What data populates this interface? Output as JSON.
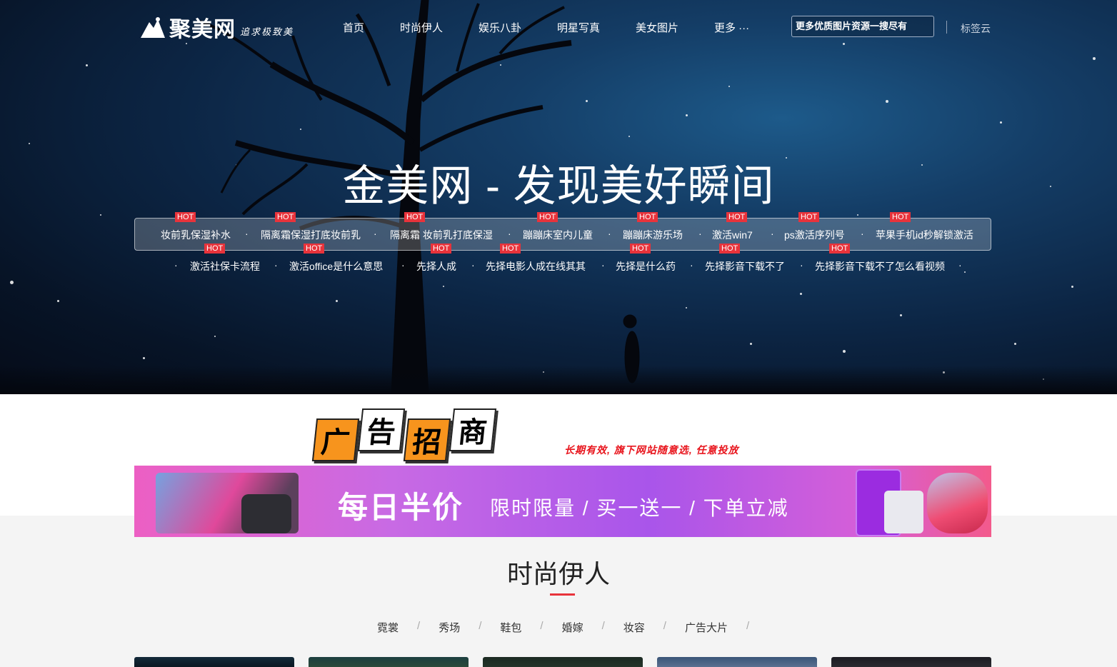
{
  "header": {
    "logo_text": "聚美网",
    "logo_slogan": "追求极致美",
    "nav": [
      "首页",
      "时尚伊人",
      "娱乐八卦",
      "明星写真",
      "美女图片",
      "更多 ···"
    ],
    "search_placeholder": "更多优质图片资源一搜尽有",
    "tag_cloud": "标签云"
  },
  "hero": {
    "title": "金美网 - 发现美好瞬间",
    "hot_badge": "HOT",
    "hot_row1": [
      "妆前乳保湿补水",
      "隔离霜保湿打底妆前乳",
      "隔离霜 妆前乳打底保湿",
      "蹦蹦床室内儿童",
      "蹦蹦床游乐场",
      "激活win7",
      "ps激活序列号",
      "苹果手机id秒解锁激活"
    ],
    "hot_row2": [
      "激活社保卡流程",
      "激活office是什么意思",
      "先择人成",
      "先择电影人成在线其其",
      "先择是什么药",
      "先择影音下载不了",
      "先择影音下载不了怎么看视频"
    ]
  },
  "ad": {
    "logo_chars": [
      "广",
      "告",
      "招",
      "商"
    ],
    "slogan": "长期有效, 旗下网站随意选, 任意投放",
    "banner_big": "每日半价",
    "banner_small": "限时限量 / 买一送一 / 下单立减"
  },
  "section": {
    "title": "时尚伊人",
    "categories": [
      "霓裳",
      "秀场",
      "鞋包",
      "婚嫁",
      "妆容",
      "广告大片"
    ],
    "separator": "/"
  },
  "colors": {
    "accent": "#e8333b",
    "hero_dark": "#0c2544"
  }
}
